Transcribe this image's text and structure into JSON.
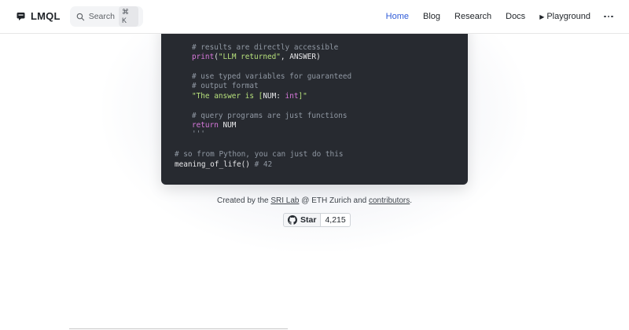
{
  "header": {
    "brand": "LMQL",
    "search": {
      "label": "Search",
      "shortcut": "⌘ K"
    },
    "nav": [
      {
        "label": "Home",
        "active": true
      },
      {
        "label": "Blog"
      },
      {
        "label": "Research"
      },
      {
        "label": "Docs"
      },
      {
        "label": "Playground",
        "icon": "play-icon"
      }
    ],
    "more_icon": "ellipsis-icon"
  },
  "code": {
    "lines": [
      {
        "parts": [
          {
            "cls": "c",
            "text": "# results are directly accessible"
          }
        ]
      },
      {
        "parts": [
          {
            "cls": "k",
            "text": "print"
          },
          {
            "cls": "t",
            "text": "("
          },
          {
            "cls": "s",
            "text": "\"LLM returned\""
          },
          {
            "cls": "t",
            "text": ", ANSWER)"
          }
        ]
      },
      {
        "parts": [
          {
            "cls": "c",
            "text": "# use typed variables for guaranteed"
          }
        ]
      },
      {
        "parts": [
          {
            "cls": "c",
            "text": "# output format"
          }
        ]
      },
      {
        "parts": [
          {
            "cls": "s",
            "text": "\"The answer is ["
          },
          {
            "cls": "t",
            "text": "NUM: "
          },
          {
            "cls": "k",
            "text": "int"
          },
          {
            "cls": "s",
            "text": "]\""
          }
        ]
      },
      {
        "parts": [
          {
            "cls": "c",
            "text": "# query programs are just functions"
          }
        ]
      },
      {
        "parts": [
          {
            "cls": "k",
            "text": "return"
          },
          {
            "cls": "t",
            "text": " NUM"
          }
        ]
      },
      {
        "parts": [
          {
            "cls": "c",
            "text": "'''"
          }
        ]
      },
      {
        "parts": [
          {
            "cls": "c",
            "text": "# so from Python, you can just do this"
          }
        ]
      },
      {
        "parts": [
          {
            "cls": "t",
            "text": "meaning_of_life() "
          },
          {
            "cls": "c",
            "text": "# 42"
          }
        ]
      }
    ]
  },
  "footer": {
    "credit_prefix": "Created by the ",
    "sri_lab": "SRI Lab",
    "credit_middle": " @ ETH Zurich and ",
    "contributors": "contributors",
    "credit_suffix": ".",
    "github": {
      "label": "Star",
      "count": "4,215",
      "icon": "github-icon"
    }
  }
}
